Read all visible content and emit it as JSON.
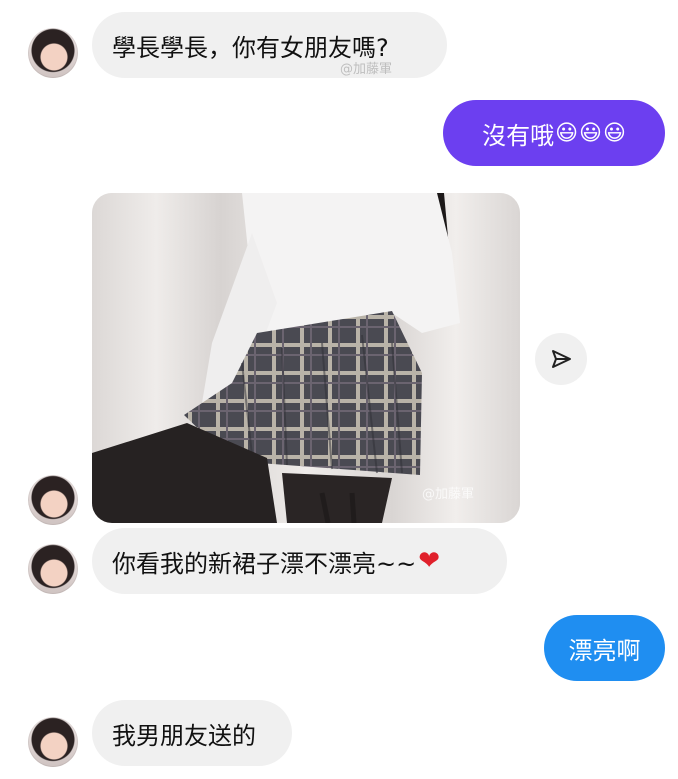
{
  "messages": {
    "m1": {
      "text": "學長學長，你有女朋友嗎?",
      "watermark": "@加藤軍"
    },
    "m2": {
      "text": "沒有哦",
      "emojis": [
        "😃",
        "😃",
        "😃"
      ]
    },
    "m3": {
      "image_alt": "girl in white sweater and plaid pleated skirt",
      "watermark": "@加藤軍"
    },
    "m4": {
      "text": "你看我的新裙子漂不漂亮~~",
      "heart": "❤"
    },
    "m5": {
      "text": "漂亮啊"
    },
    "m6": {
      "text": "我男朋友送的"
    }
  },
  "colors": {
    "incoming_bubble": "#f0f0f0",
    "outgoing_purple": "#6c3ff0",
    "outgoing_blue": "#1f8ef1"
  },
  "icons": {
    "share": "send-icon",
    "avatar": "profile-avatar"
  }
}
